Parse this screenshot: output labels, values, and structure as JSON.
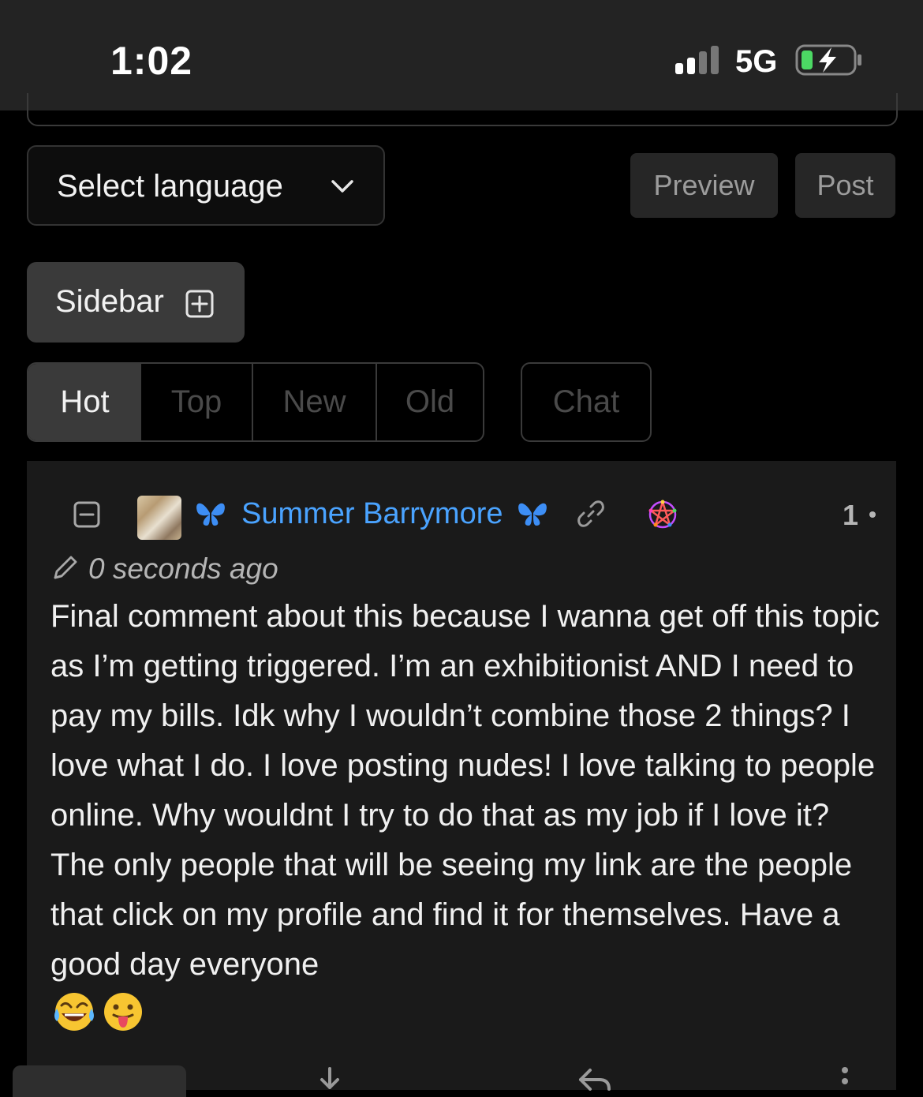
{
  "status_bar": {
    "time": "1:02",
    "network": "5G",
    "icons": [
      "signal-icon",
      "battery-charging-icon"
    ]
  },
  "editor": {
    "language_select_label": "Select language",
    "preview_label": "Preview",
    "post_label": "Post"
  },
  "sidebar": {
    "label": "Sidebar"
  },
  "sort_tabs": {
    "hot": "Hot",
    "top": "Top",
    "new": "New",
    "old": "Old",
    "chat": "Chat",
    "selected": "Hot"
  },
  "comment": {
    "username": "Summer Barrymore",
    "score": "1",
    "timestamp": "0 seconds ago",
    "body": "Final comment about this because I wanna get off this topic as I’m getting triggered. I’m an exhibitionist AND I need to pay my bills. Idk why I wouldn’t combine those 2 things? I love what I do. I love posting nudes! I love talking to people online. Why wouldnt I try to do that as my job if I love it? The only people that will be seeing my link are the people that click on my profile and find it for themselves. Have a good day everyone",
    "emojis": [
      "😂",
      "😛"
    ],
    "colors": {
      "username": "#4aa3ff",
      "card_bg": "#1a1a1a"
    }
  }
}
